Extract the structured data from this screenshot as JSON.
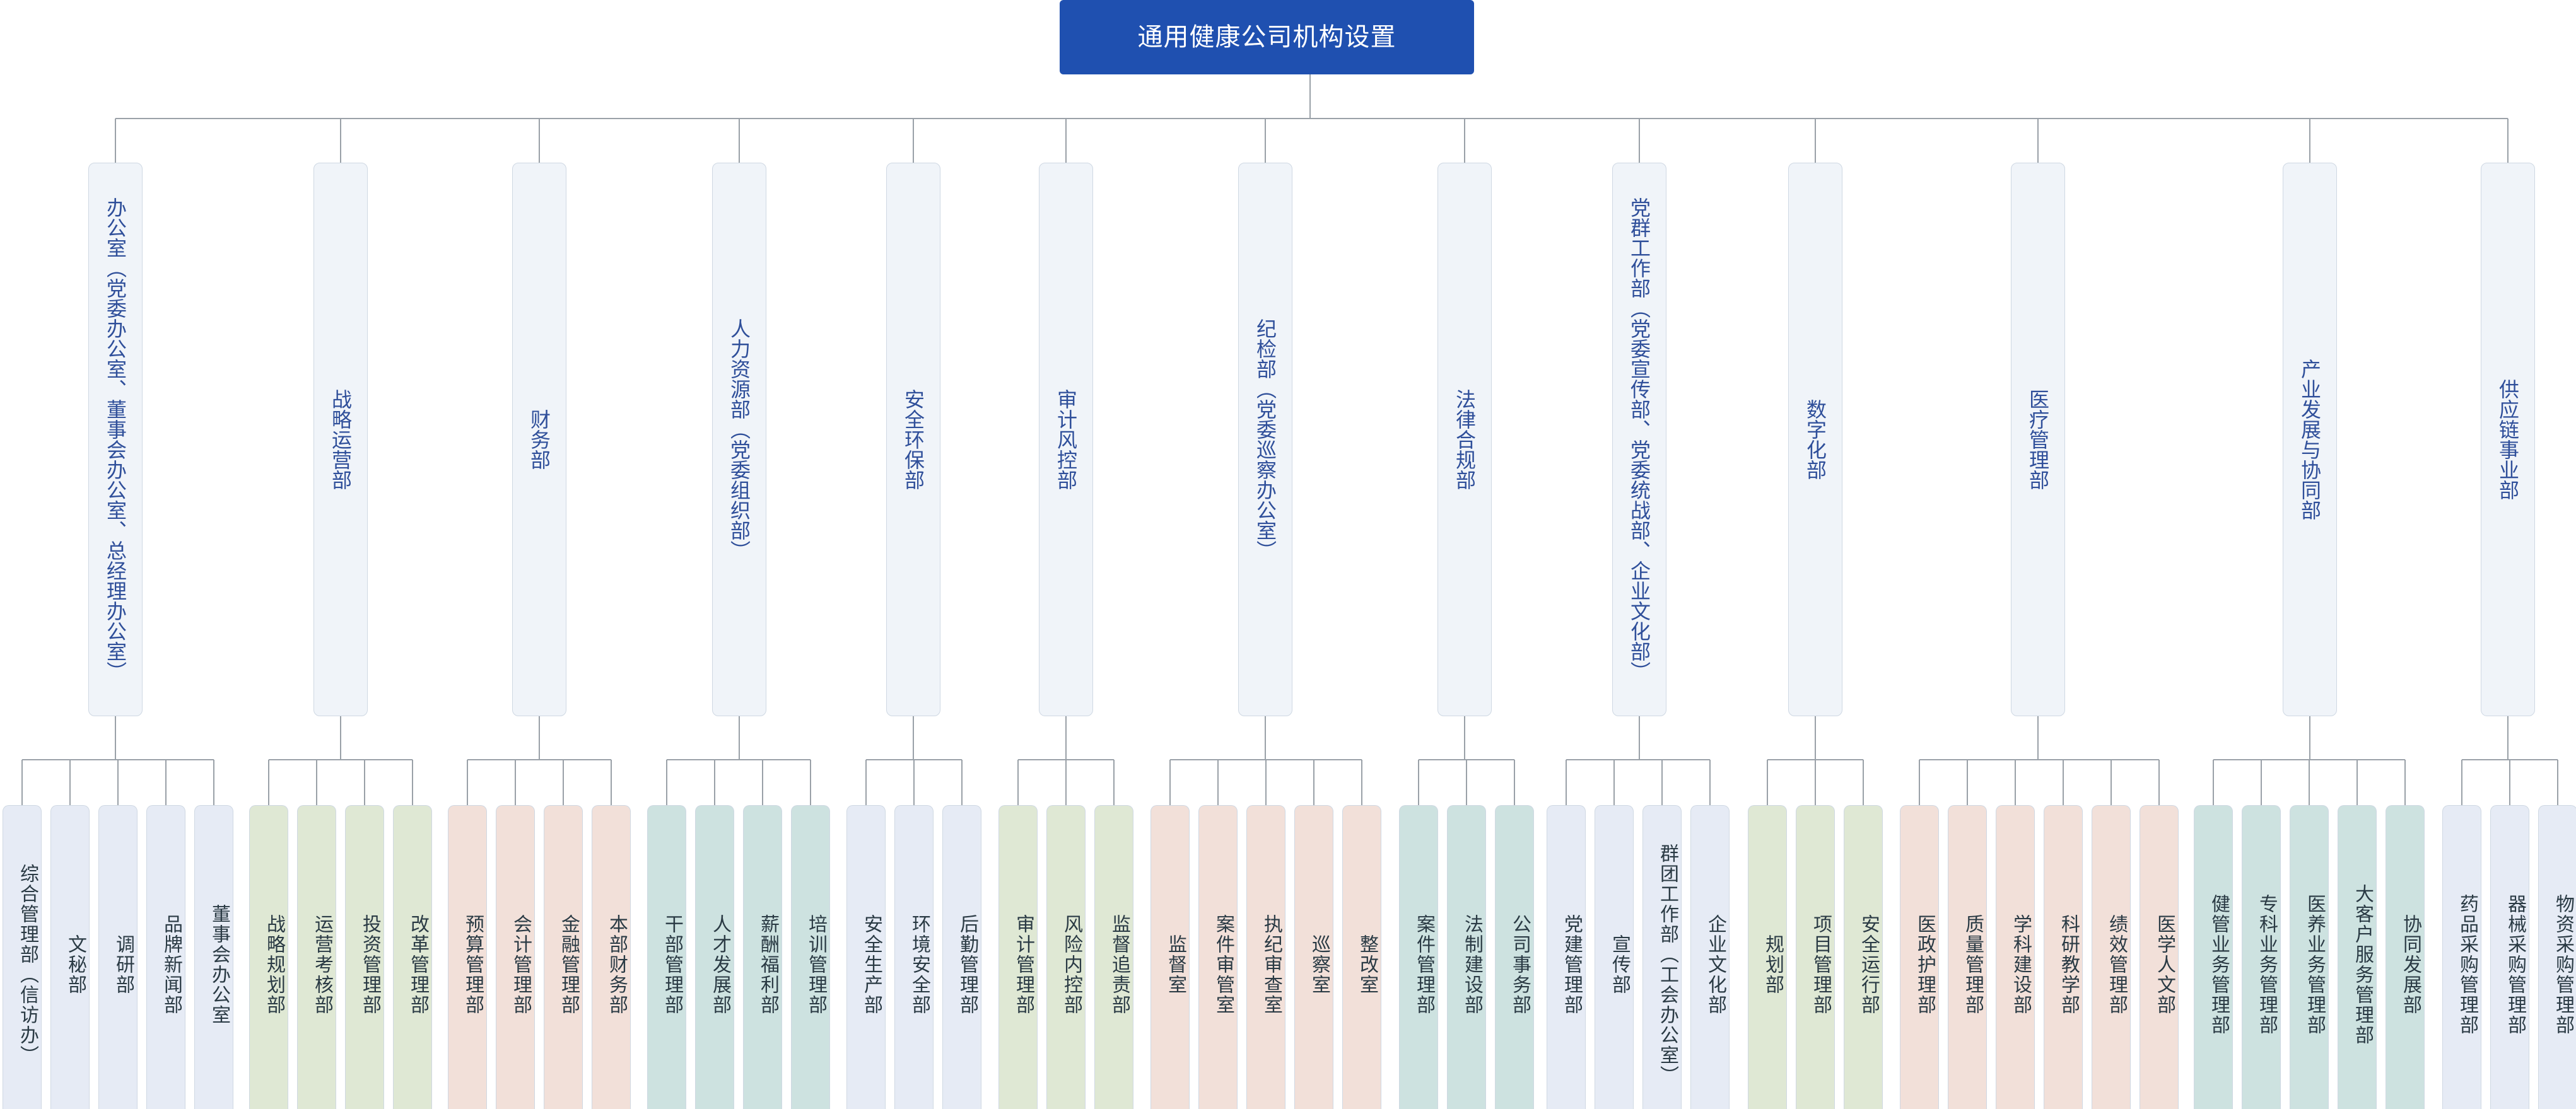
{
  "title": "通用健康公司机构设置",
  "colors": {
    "root_bg": "#1f50b0",
    "root_text": "#ffffff",
    "level1_bg": "#f0f4f9",
    "level1_text": "#2f4f9a",
    "connector": "#9aa1a8",
    "palette": {
      "blue": "#e6ebf5",
      "green": "#dfe8d4",
      "pink": "#f2e0d9",
      "teal": "#cde2e0"
    }
  },
  "departments": [
    {
      "name": "办公室（党委办公室、董事会办公室、总经理办公室）",
      "color": "blue",
      "children": [
        "综合管理部（信访办）",
        "文秘部",
        "调研部",
        "品牌新闻部",
        "董事会办公室"
      ]
    },
    {
      "name": "战略运营部",
      "color": "green",
      "children": [
        "战略规划部",
        "运营考核部",
        "投资管理部",
        "改革管理部"
      ]
    },
    {
      "name": "财务部",
      "color": "pink",
      "children": [
        "预算管理部",
        "会计管理部",
        "金融管理部",
        "本部财务部"
      ]
    },
    {
      "name": "人力资源部（党委组织部）",
      "color": "teal",
      "children": [
        "干部管理部",
        "人才发展部",
        "薪酬福利部",
        "培训管理部"
      ]
    },
    {
      "name": "安全环保部",
      "color": "blue",
      "children": [
        "安全生产部",
        "环境安全部",
        "后勤管理部"
      ]
    },
    {
      "name": "审计风控部",
      "color": "green",
      "children": [
        "审计管理部",
        "风险内控部",
        "监督追责部"
      ]
    },
    {
      "name": "纪检部（党委巡察办公室）",
      "color": "pink",
      "children": [
        "监督室",
        "案件审管室",
        "执纪审查室",
        "巡察室",
        "整改室"
      ]
    },
    {
      "name": "法律合规部",
      "color": "teal",
      "children": [
        "案件管理部",
        "法制建设部",
        "公司事务部"
      ]
    },
    {
      "name": "党群工作部（党委宣传部、党委统战部、企业文化部）",
      "color": "blue",
      "children": [
        "党建管理部",
        "宣传部",
        "群团工作部（工会办公室）",
        "企业文化部"
      ]
    },
    {
      "name": "数字化部",
      "color": "green",
      "children": [
        "规划部",
        "项目管理部",
        "安全运行部"
      ]
    },
    {
      "name": "医疗管理部",
      "color": "pink",
      "children": [
        "医政护理部",
        "质量管理部",
        "学科建设部",
        "科研教学部",
        "绩效管理部",
        "医学人文部"
      ]
    },
    {
      "name": "产业发展与协同部",
      "color": "teal",
      "children": [
        "健管业务管理部",
        "专科业务管理部",
        "医养业务管理部",
        "大客户服务管理部",
        "协同发展部"
      ]
    },
    {
      "name": "供应链事业部",
      "color": "blue",
      "children": [
        "药品采购管理部",
        "器械采购管理部",
        "物资采购管理部"
      ]
    }
  ]
}
